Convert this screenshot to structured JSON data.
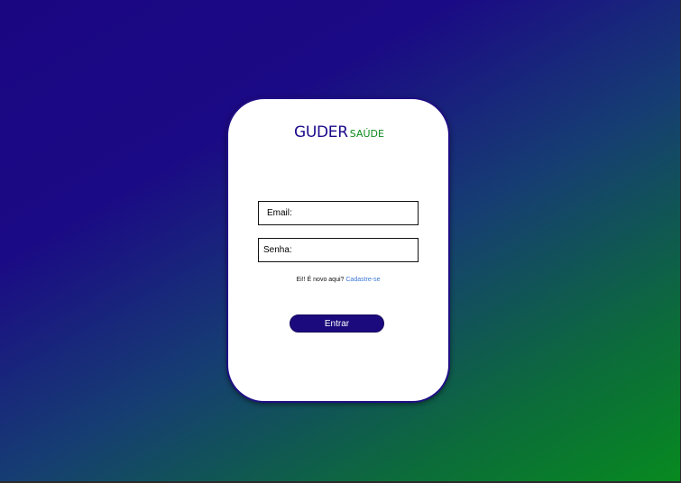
{
  "login_card": {
    "logo": {
      "brand": "GUDER",
      "tagline": "SAÚDE"
    },
    "email_field": {
      "placeholder": "Email:"
    },
    "password_field": {
      "placeholder": "Senha:"
    },
    "signup": {
      "prompt": "Ei!! É novo aqui?",
      "link_label": "Cadastre-se"
    },
    "submit_label": "Entrar"
  },
  "colors": {
    "brand_primary": "#1b0a8a",
    "brand_secondary": "#0c8a1e",
    "link": "#3a78d6",
    "background_start": "#1b0682",
    "background_end": "#078a1f"
  }
}
